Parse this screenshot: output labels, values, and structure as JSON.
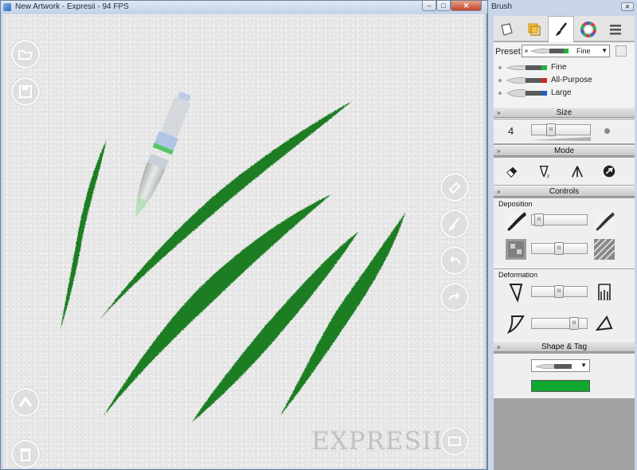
{
  "main_window": {
    "title": "New Artwork - Expresii - 94 FPS",
    "controls": {
      "minimize": "–",
      "maximize": "□",
      "close": "✕"
    },
    "watermark": "EXPRESII",
    "left_buttons": [
      {
        "name": "open-file-icon",
        "glyph": "folder"
      },
      {
        "name": "save-icon",
        "glyph": "disk"
      },
      {
        "name": "navigate-icon",
        "glyph": "arrow"
      },
      {
        "name": "trash-icon",
        "glyph": "trash"
      }
    ],
    "right_buttons": [
      {
        "name": "eraser-tool-icon",
        "glyph": "eraser"
      },
      {
        "name": "brush-tool-icon",
        "glyph": "brush"
      },
      {
        "name": "undo-icon",
        "glyph": "undo"
      },
      {
        "name": "redo-icon",
        "glyph": "redo"
      },
      {
        "name": "fullscreen-icon",
        "glyph": "screen"
      }
    ],
    "stroke_color": "#1a7d22"
  },
  "brush_panel": {
    "title": "Brush",
    "close": "✕",
    "tabs": [
      {
        "name": "canvas-tab-icon",
        "active": false
      },
      {
        "name": "layers-tab-icon",
        "active": false
      },
      {
        "name": "brush-tab-icon",
        "active": true
      },
      {
        "name": "color-tab-icon",
        "active": false
      },
      {
        "name": "menu-tab-icon",
        "active": false
      }
    ],
    "preset": {
      "label": "Preset",
      "selected": "Fine",
      "items": [
        {
          "label": "Fine",
          "color": "#21b13a"
        },
        {
          "label": "All-Purpose",
          "color": "#d02525"
        },
        {
          "label": "Large",
          "color": "#1f5fbf"
        }
      ]
    },
    "size": {
      "header": "Size",
      "value": "4",
      "slider": 0.3
    },
    "mode": {
      "header": "Mode",
      "icons": [
        "eraser-mode-icon",
        "deposit-mode-icon",
        "split-mode-icon",
        "dry-mode-icon"
      ]
    },
    "controls": {
      "header": "Controls",
      "deposition_label": "Deposition",
      "deposition_sliders": [
        0.05,
        0.5
      ],
      "deformation_label": "Deformation",
      "deformation_sliders": [
        0.5,
        0.85
      ]
    },
    "shape_tag": {
      "header": "Shape & Tag",
      "tag_color": "#10a831"
    }
  }
}
